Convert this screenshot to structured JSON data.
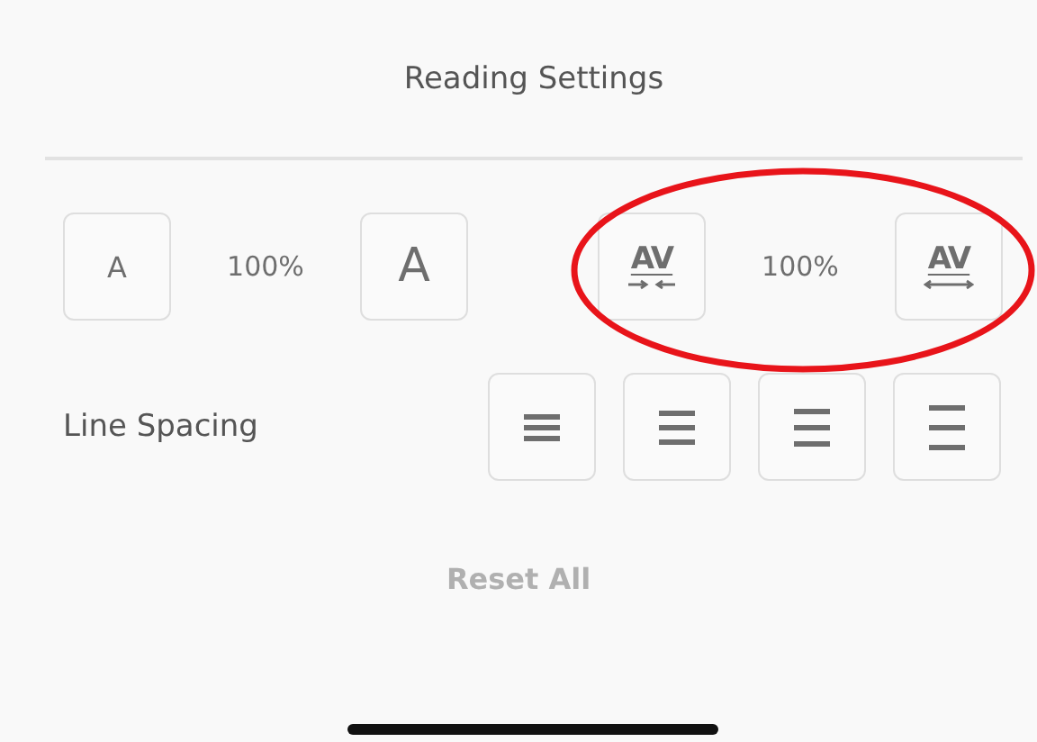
{
  "title": "Reading Settings",
  "font_size": {
    "smaller": "A",
    "value": "100%",
    "larger": "A"
  },
  "char_spacing": {
    "tighter": "AV",
    "value": "100%",
    "wider": "AV"
  },
  "line_spacing": {
    "label": "Line Spacing",
    "options": [
      {
        "kind": "tight"
      },
      {
        "kind": "normal"
      },
      {
        "kind": "loose"
      },
      {
        "kind": "wide"
      }
    ]
  },
  "reset": "Reset All",
  "annotation": {
    "kind": "ellipse",
    "color": "#e8141a"
  }
}
